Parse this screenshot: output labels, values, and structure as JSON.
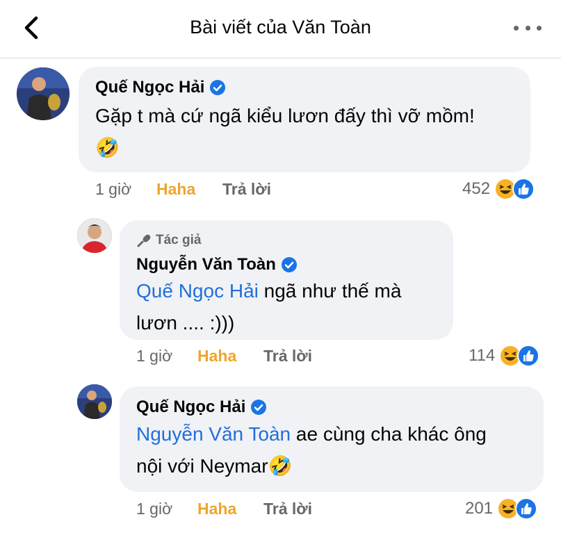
{
  "header": {
    "title": "Bài viết của Văn Toàn"
  },
  "comments": [
    {
      "name": "Quế Ngọc Hải",
      "text": "Gặp t mà cứ ngã kiểu lươn đấy thì vỡ mồm!",
      "emoji": "🤣",
      "time": "1 giờ",
      "haha": "Haha",
      "reply": "Trả lời",
      "count": "452"
    },
    {
      "author_tag": "Tác giả",
      "name": "Nguyễn Văn Toàn",
      "mention": "Quế Ngọc Hải",
      "text_line1": " ngã như thế mà",
      "text_line2": "lươn ....  :)))",
      "time": "1 giờ",
      "haha": "Haha",
      "reply": "Trả lời",
      "count": "114"
    },
    {
      "name": "Quế Ngọc Hải",
      "mention": "Nguyễn Văn Toàn",
      "text_line1": " ae cùng cha khác ông",
      "text_line2": "nội với Neymar",
      "emoji": "🤣",
      "time": "1 giờ",
      "haha": "Haha",
      "reply": "Trả lời",
      "count": "201"
    }
  ],
  "colors": {
    "mention": "#216fdb",
    "haha": "#eda52a",
    "verified": "#1b74e4",
    "bubble": "#f0f2f5"
  }
}
